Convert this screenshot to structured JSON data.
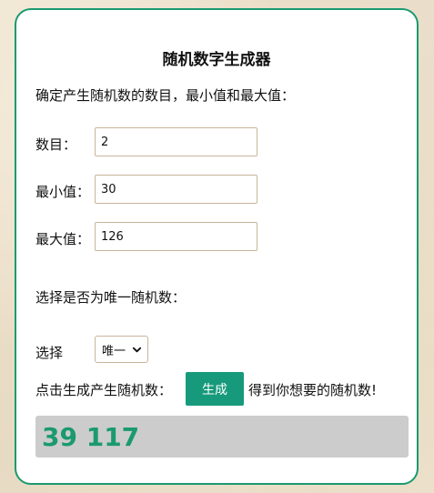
{
  "form": {
    "title": "随机数字生成器",
    "intro": "确定产生随机数的数目，最小值和最大值：",
    "count_label": "数目：",
    "count_value": "2",
    "min_label": "最小值：",
    "min_value": "30",
    "max_label": "最大值：",
    "max_value": "126",
    "unique_prompt": "选择是否为唯一随机数：",
    "select_label": "选择",
    "select_value": "唯一",
    "click_label": "点击生成产生随机数：",
    "generate_label": "生成",
    "after_label": "得到你想要的随机数!",
    "result": "39 117"
  },
  "colors": {
    "accent": "#1a9a6e",
    "button": "#179a7b",
    "result_bg": "#cccccc",
    "input_border": "#c9b49b"
  }
}
